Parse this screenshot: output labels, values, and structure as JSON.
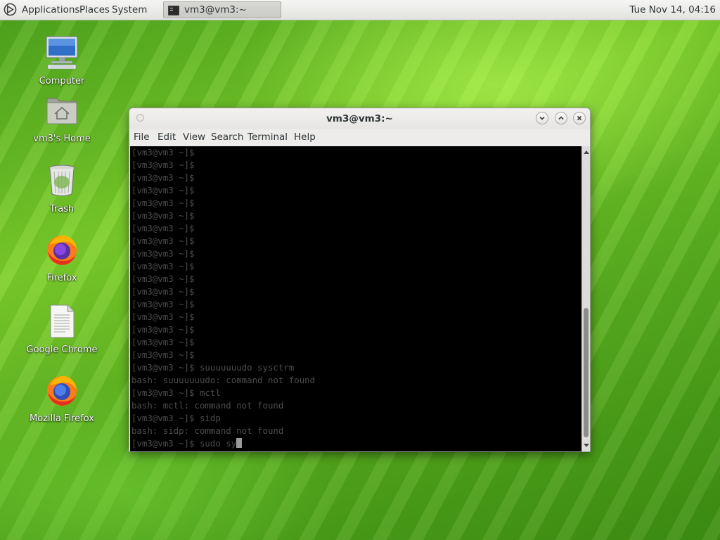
{
  "top_panel": {
    "menus": [
      "Applications",
      "Places",
      "System"
    ],
    "task_label": "vm3@vm3:~",
    "clock": "Tue Nov 14, 04:16"
  },
  "desktop_icons": [
    {
      "label": "Computer",
      "icon": "computer-icon"
    },
    {
      "label": "vm3's Home",
      "icon": "home-folder-icon"
    },
    {
      "label": "Trash",
      "icon": "trash-icon"
    },
    {
      "label": "Firefox",
      "icon": "firefox-icon"
    },
    {
      "label": "Google Chrome",
      "icon": "document-icon"
    },
    {
      "label": "Mozilla Firefox",
      "icon": "firefox-icon"
    }
  ],
  "window": {
    "title": "vm3@vm3:~",
    "menus": [
      "File",
      "Edit",
      "View",
      "Search",
      "Terminal",
      "Help"
    ]
  },
  "terminal": {
    "lines": [
      "[vm3@vm3 ~]$",
      "[vm3@vm3 ~]$",
      "[vm3@vm3 ~]$",
      "[vm3@vm3 ~]$",
      "[vm3@vm3 ~]$",
      "[vm3@vm3 ~]$",
      "[vm3@vm3 ~]$",
      "[vm3@vm3 ~]$",
      "[vm3@vm3 ~]$",
      "[vm3@vm3 ~]$",
      "[vm3@vm3 ~]$",
      "[vm3@vm3 ~]$",
      "[vm3@vm3 ~]$",
      "[vm3@vm3 ~]$",
      "[vm3@vm3 ~]$",
      "[vm3@vm3 ~]$",
      "[vm3@vm3 ~]$",
      "[vm3@vm3 ~]$ suuuuuuudo sysctrm",
      "bash: suuuuuuudo: command not found",
      "[vm3@vm3 ~]$ mctl",
      "bash: mctl: command not found",
      "[vm3@vm3 ~]$ sidp",
      "bash: sidp: command not found",
      "[vm3@vm3 ~]$ sudo sy"
    ]
  },
  "colors": {
    "terminal_bg": "#000000",
    "terminal_text": "#4c4c4c",
    "panel_bg": "#ebebe8"
  }
}
